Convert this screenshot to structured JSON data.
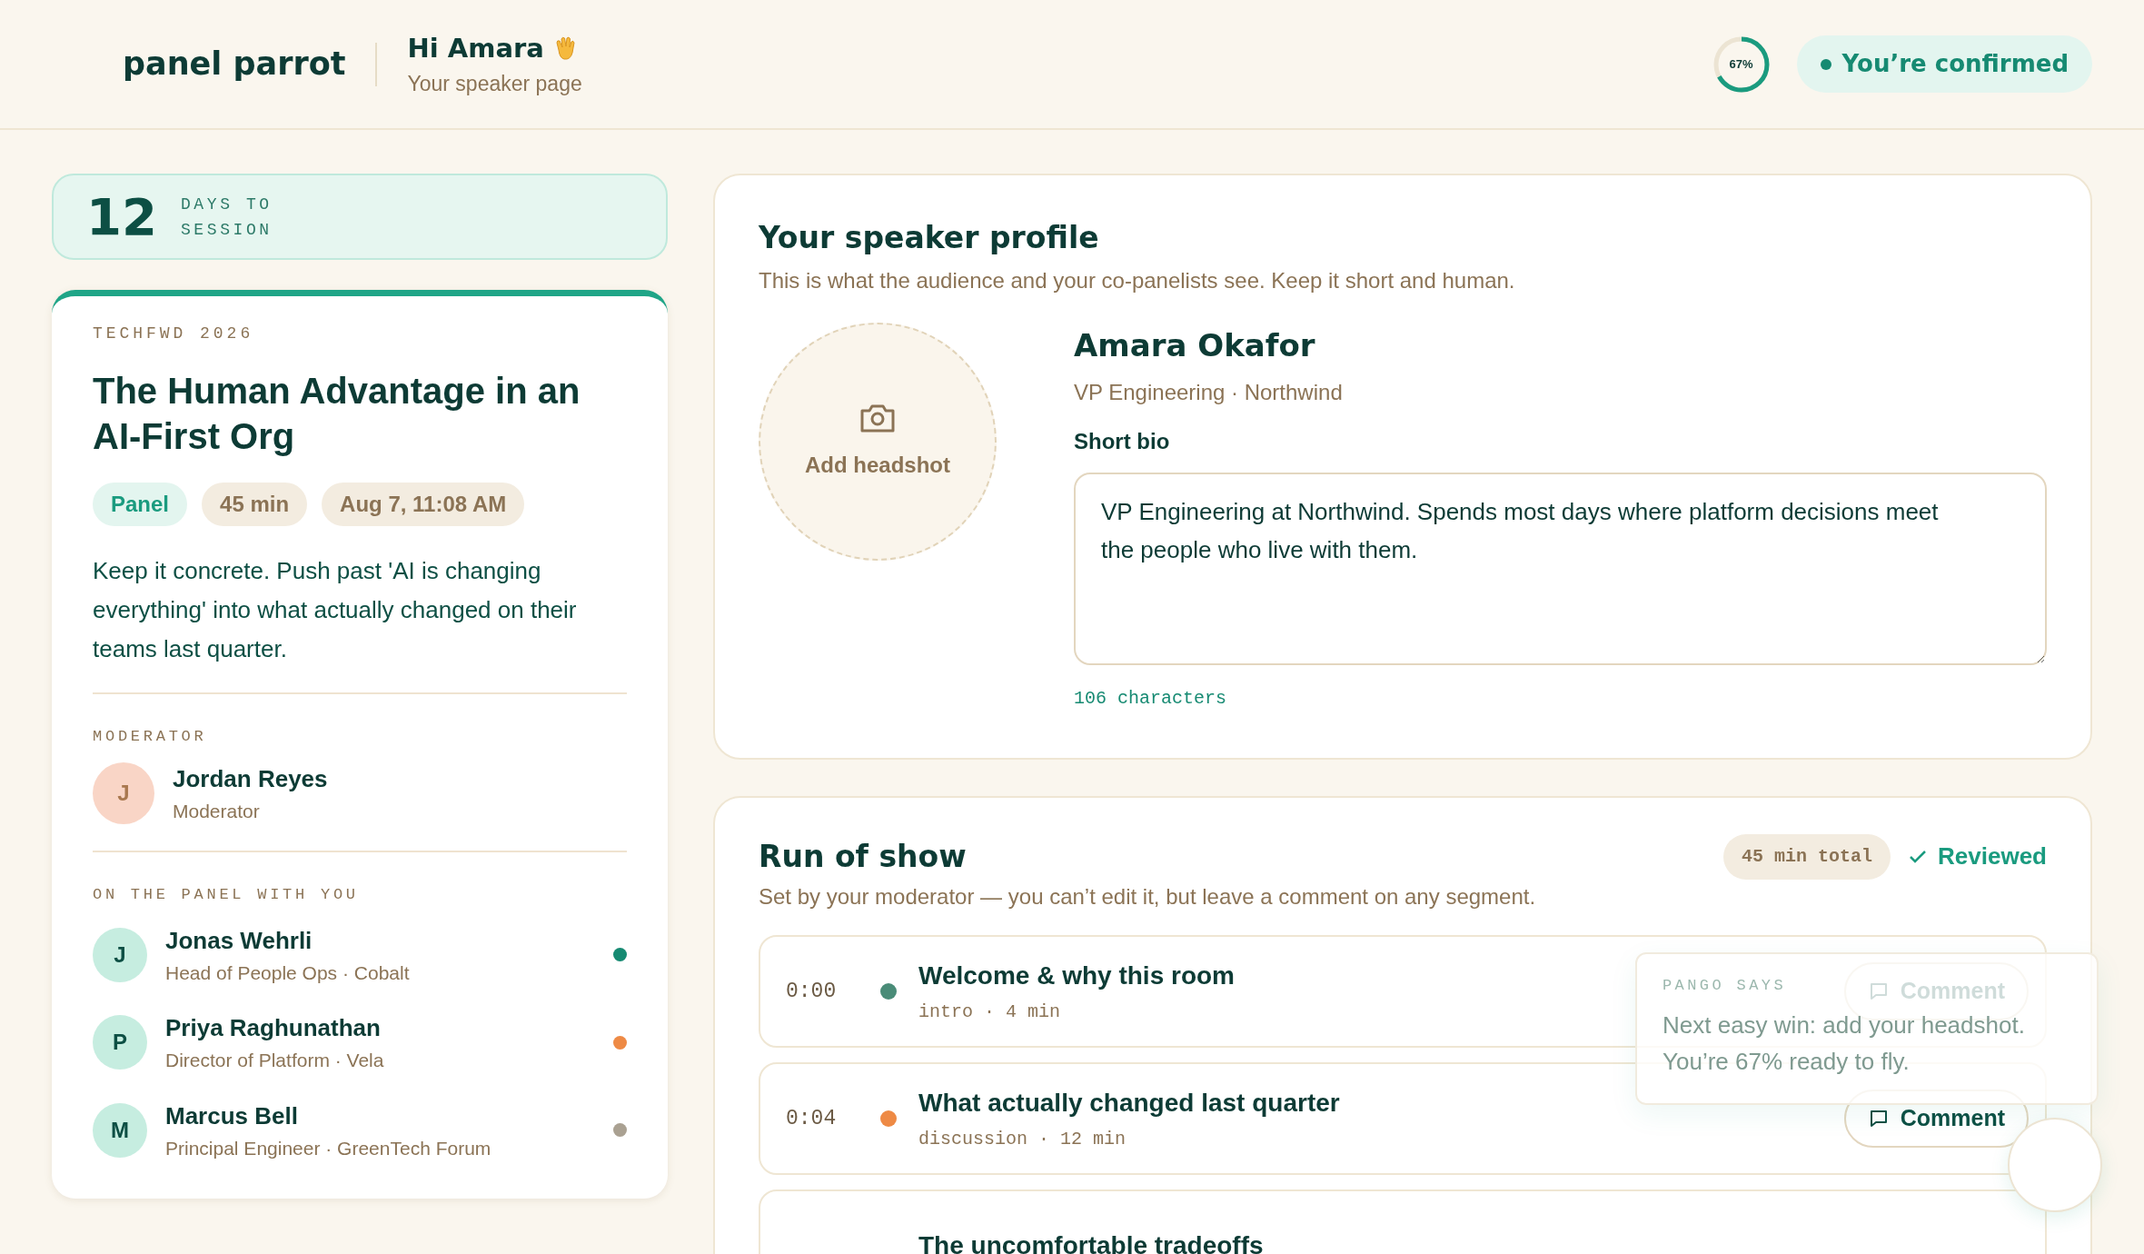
{
  "header": {
    "logo": "panel parrot",
    "greeting": "Hi Amara",
    "subtitle": "Your speaker page",
    "progress": {
      "level": 0.67,
      "label": "67%"
    },
    "status": "You’re confirmed"
  },
  "countdown": {
    "number": "12",
    "label": "DAYS TO SESSION"
  },
  "session": {
    "event": "TECHFWD 2026",
    "title": "The Human Advantage in an AI-First Org",
    "tags": [
      {
        "label": "Panel",
        "kind": "format"
      },
      {
        "label": "45 min",
        "kind": "meta"
      },
      {
        "label": "Aug 7, 11:08 AM",
        "kind": "meta"
      }
    ],
    "brief": "Keep it concrete. Push past 'AI is changing everything' into what actually changed on their teams last quarter.",
    "moderator_heading": "MODERATOR",
    "moderator": {
      "initial": "J",
      "name": "Jordan Reyes",
      "role": "Moderator"
    },
    "panel_heading": "ON THE PANEL WITH YOU",
    "panelists": [
      {
        "initial": "J",
        "name": "Jonas Wehrli",
        "role": "Head of People Ops · Cobalt",
        "color": "#168a72"
      },
      {
        "initial": "P",
        "name": "Priya Raghunathan",
        "role": "Director of Platform · Vela",
        "color": "#ee8a45"
      },
      {
        "initial": "M",
        "name": "Marcus Bell",
        "role": "Principal Engineer · GreenTech Forum",
        "color": "#aaa192"
      }
    ]
  },
  "profile": {
    "title": "Your speaker profile",
    "subtitle": "This is what the audience and your co-panelists see. Keep it short and human.",
    "headshot": "Add headshot",
    "name": "Amara Okafor",
    "role": "VP Engineering · Northwind",
    "bio_label": "Short bio",
    "bio": "VP Engineering at Northwind. Spends most days where platform decisions meet the people who live with them.",
    "char_count": "106 characters"
  },
  "run_of_show": {
    "title": "Run of show",
    "subtitle": "Set by your moderator — you can’t edit it, but leave a comment on any segment.",
    "total": "45 min total",
    "reviewed": "Reviewed",
    "segments": [
      {
        "time": "0:00",
        "color": "#4a8c78",
        "title": "Welcome & why this room",
        "meta": "intro · 4 min",
        "action": "Comment"
      },
      {
        "time": "0:04",
        "color": "#ee8a45",
        "title": "What actually changed last quarter",
        "meta": "discussion · 12 min",
        "action": "Comment"
      },
      {
        "title": "The uncomfortable tradeoffs"
      }
    ]
  },
  "tip": {
    "heading": "PANGO SAYS",
    "text": "Next easy win: add your headshot. You’re 67% ready to fly."
  }
}
